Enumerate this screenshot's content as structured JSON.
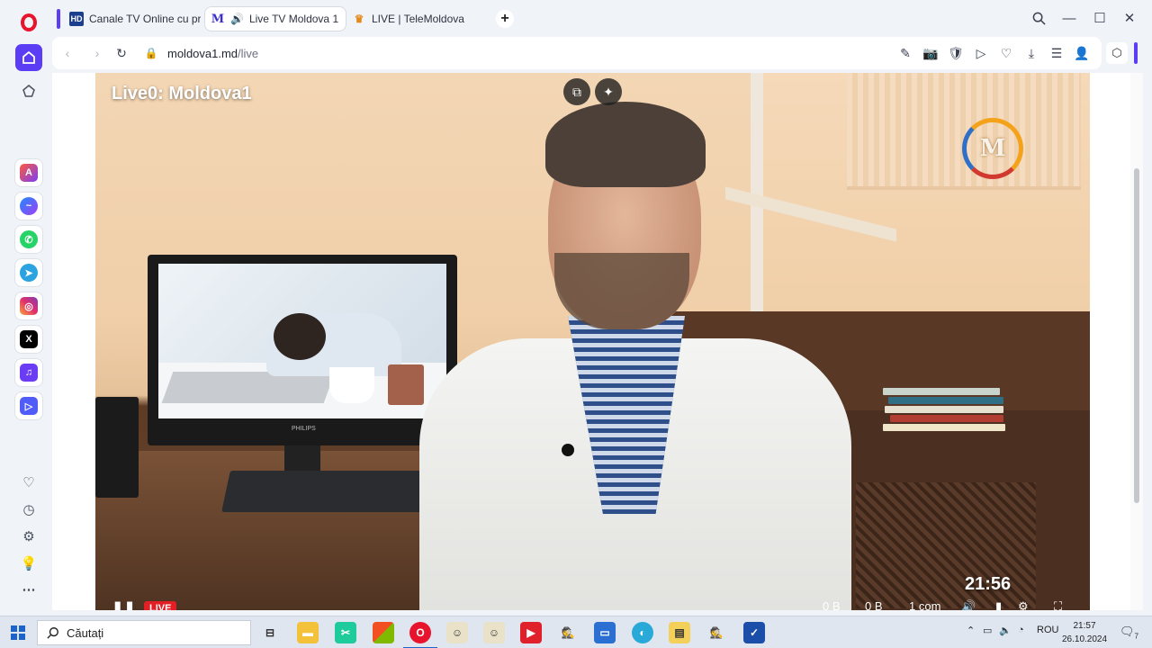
{
  "tabs": [
    {
      "label": "Canale TV Online cu progr",
      "icon": "HD",
      "active": false
    },
    {
      "label": "Live TV Moldova 1",
      "icon": "M",
      "active": true
    },
    {
      "label": "LIVE | TeleMoldova",
      "icon": "crown",
      "active": false
    }
  ],
  "address": {
    "domain": "moldova1.md",
    "path": "/live"
  },
  "video": {
    "title": "Live0: Moldova1",
    "logo": "M",
    "time": "21:56",
    "live_label": "LIVE",
    "monitor_brand": "PHILIPS",
    "controls": {
      "stat1": "0 B",
      "stat2": "0 B",
      "quality": "1 com"
    }
  },
  "taskbar": {
    "search_placeholder": "Căutați",
    "language": "ROU",
    "time": "21:57",
    "date": "26.10.2024",
    "notifications": "7"
  },
  "colors": {
    "accent": "#5b3df5",
    "opera_red": "#e8132d",
    "live_red": "#e31f26"
  }
}
